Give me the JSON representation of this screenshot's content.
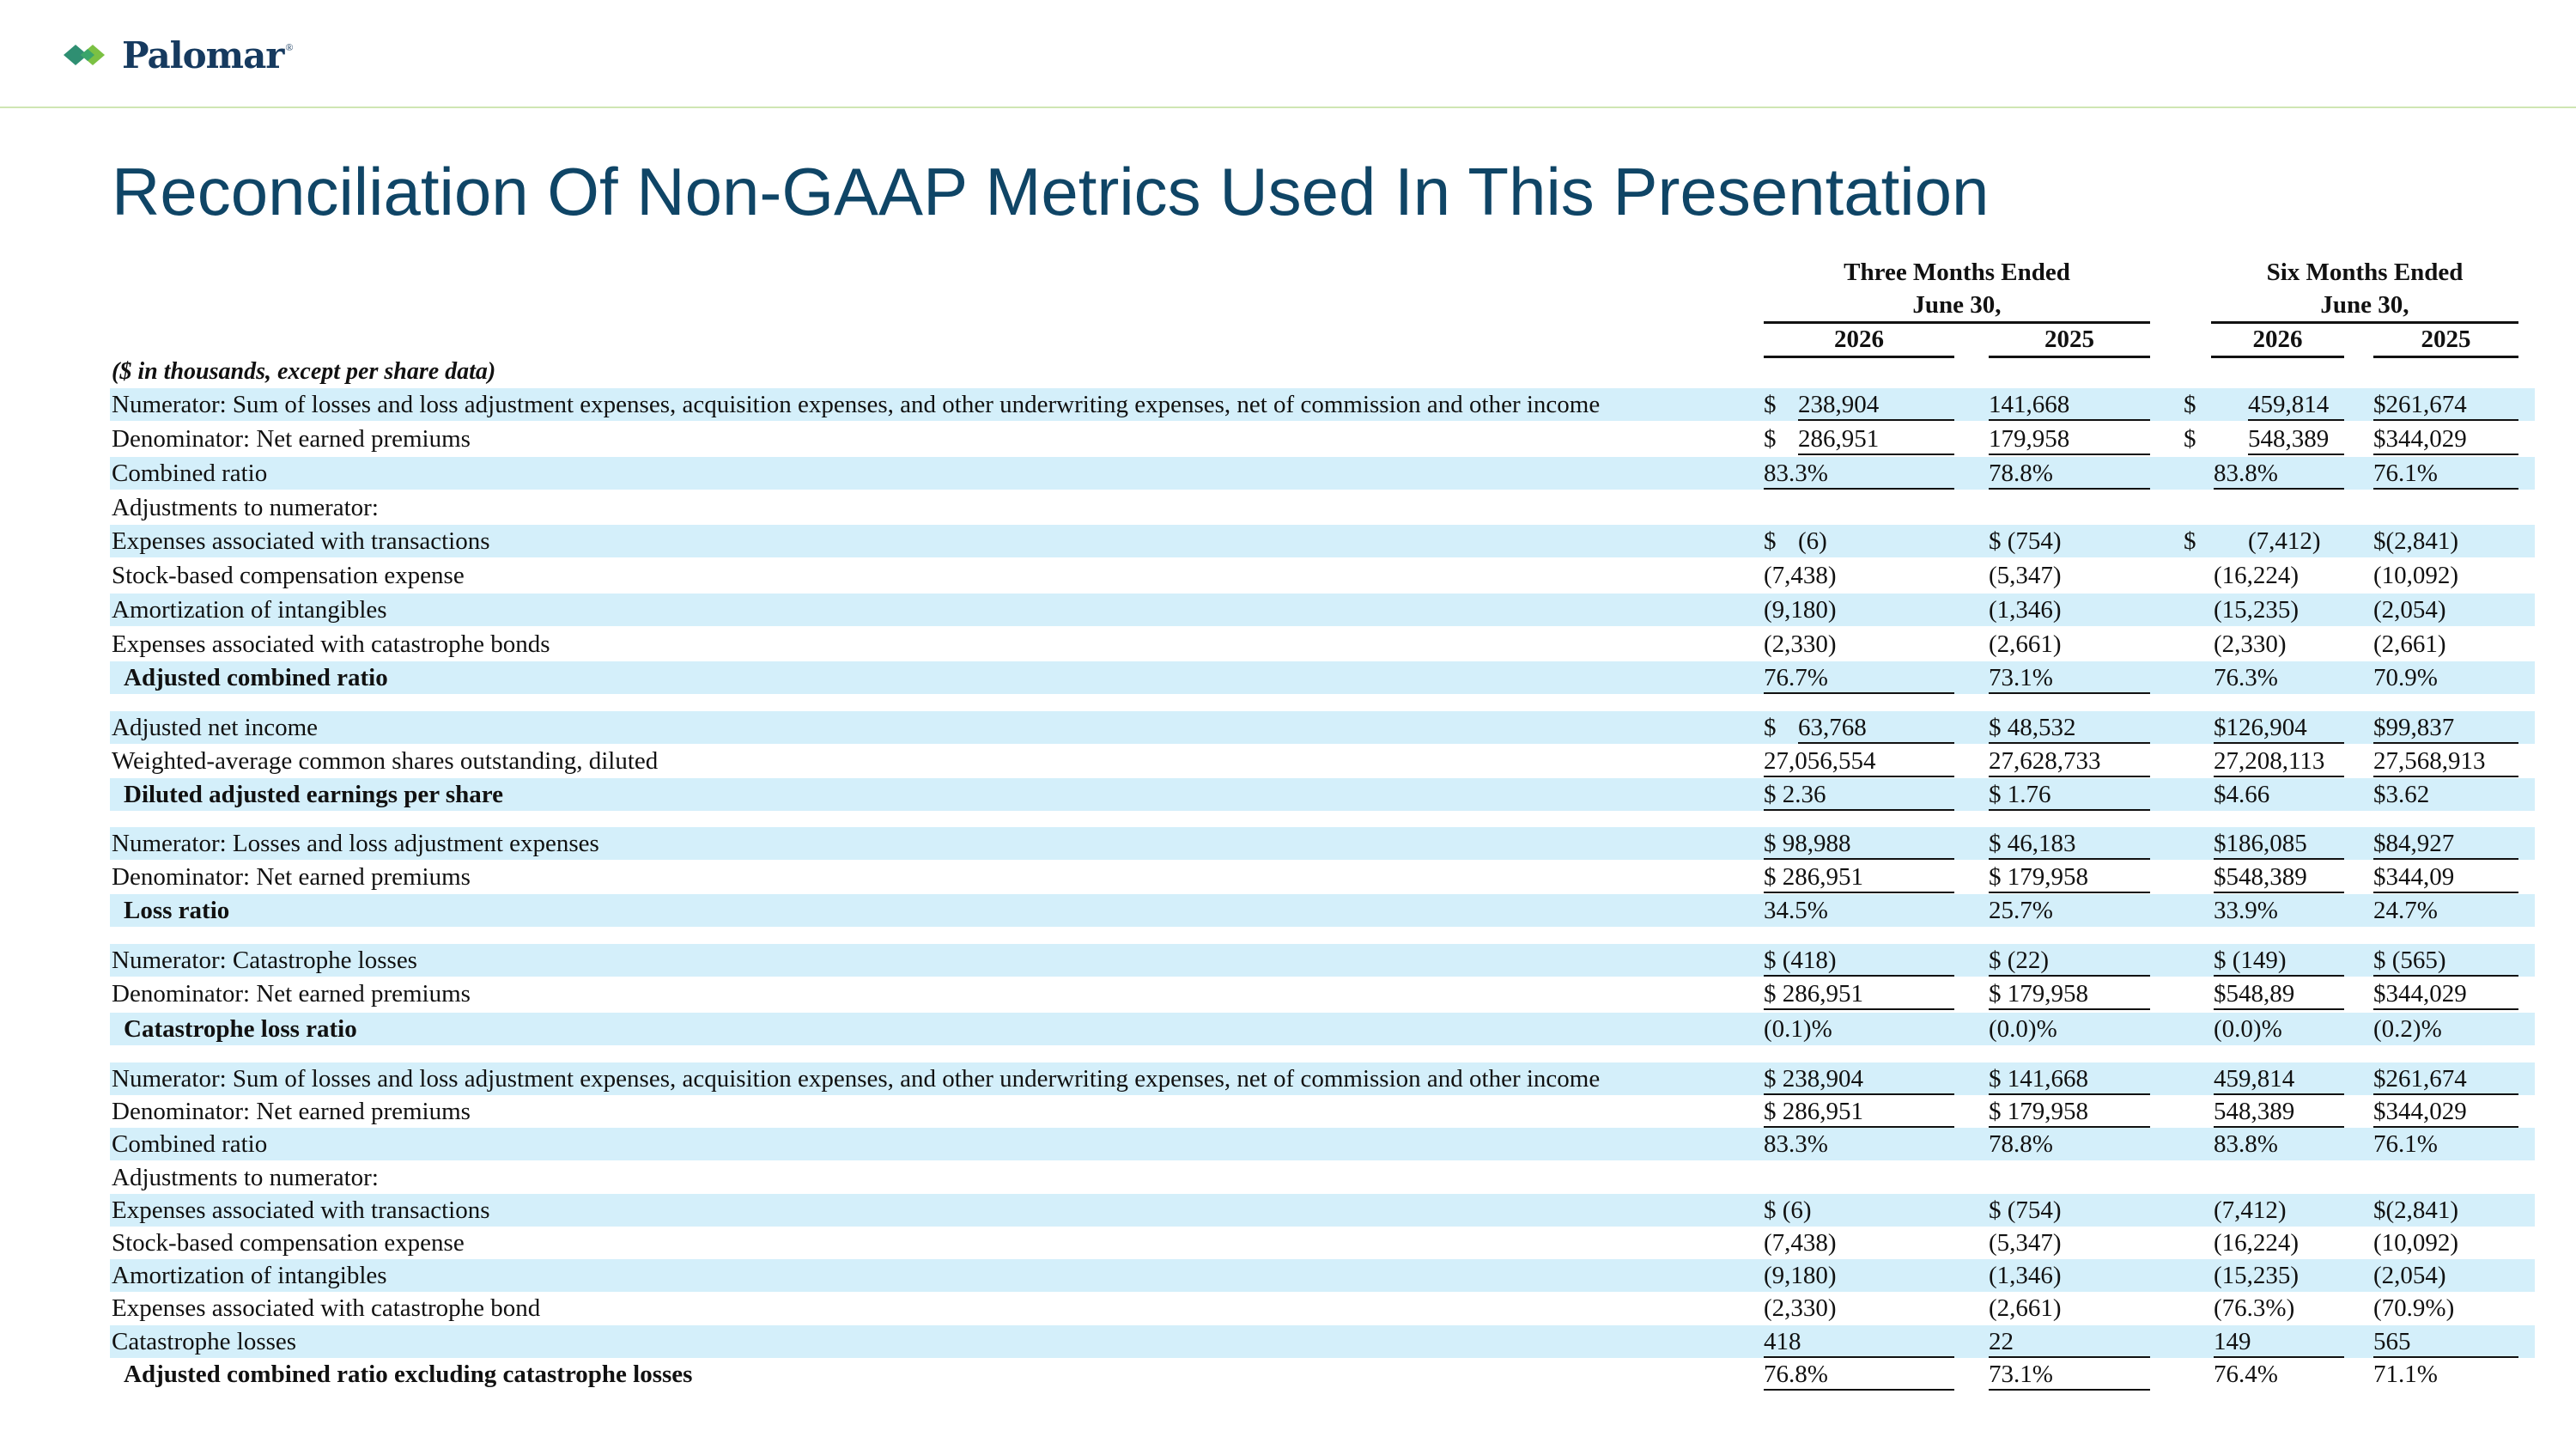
{
  "brand": {
    "name": "Palomar",
    "reg": "®",
    "colors": {
      "title": "#0f4566",
      "shade": "#d4effa",
      "rule": "#cfe6b3"
    }
  },
  "title": "Reconciliation Of Non-GAAP Metrics Used In This Presentation",
  "table": {
    "group_three_line1": "Three Months Ended",
    "group_three_line2": "June 30,",
    "group_six_line1": "Six Months Ended",
    "group_six_line2": "June 30,",
    "years": [
      "2026",
      "2025",
      "2026",
      "2025"
    ],
    "units_note": "($ in thousands, except per share data)",
    "rows": [
      {
        "label": "Numerator: Sum of losses and loss adjustment expenses, acquisition expenses, and other underwriting expenses, net of commission and other income",
        "cur1": "$",
        "v1": "238,904",
        "v2": "141,668",
        "cur3": "$",
        "v3": "459,814",
        "v4": "$261,674"
      },
      {
        "label": "Denominator: Net earned premiums",
        "cur1": "$",
        "v1": "286,951",
        "v2": "179,958",
        "cur3": "$",
        "v3": "548,389",
        "v4": "$344,029"
      },
      {
        "label": "Combined ratio",
        "cur1": "",
        "v1": "83.3%",
        "v2": "78.8%",
        "cur3": "",
        "v3": "83.8%",
        "v4": "76.1%"
      },
      {
        "label": "Adjustments to numerator:",
        "cur1": "",
        "v1": "",
        "v2": "",
        "cur3": "",
        "v3": "",
        "v4": ""
      },
      {
        "label": "Expenses associated with transactions",
        "cur1": "$",
        "v1": "(6)",
        "v2": "$ (754)",
        "cur3": "$",
        "v3": "(7,412)",
        "v4": "$(2,841)"
      },
      {
        "label": "Stock-based compensation expense",
        "cur1": "",
        "v1": "(7,438)",
        "v2": "(5,347)",
        "cur3": "",
        "v3": "(16,224)",
        "v4": "(10,092)"
      },
      {
        "label": "Amortization of intangibles",
        "cur1": "",
        "v1": "(9,180)",
        "v2": "(1,346)",
        "cur3": "",
        "v3": "(15,235)",
        "v4": "(2,054)"
      },
      {
        "label": "Expenses associated with catastrophe bonds",
        "cur1": "",
        "v1": "(2,330)",
        "v2": "(2,661)",
        "cur3": "",
        "v3": "(2,330)",
        "v4": "(2,661)"
      },
      {
        "label": "Adjusted combined ratio",
        "cur1": "",
        "v1": "76.7%",
        "v2": "73.1%",
        "cur3": "",
        "v3": "76.3%",
        "v4": "70.9%"
      },
      {
        "label": "Adjusted net income",
        "cur1": "$",
        "v1": "63,768",
        "v2": "$ 48,532",
        "cur3": "",
        "v3": "$126,904",
        "v4": "$99,837"
      },
      {
        "label": "Weighted-average common shares outstanding, diluted",
        "cur1": "",
        "v1": "27,056,554",
        "v2": "27,628,733",
        "cur3": "",
        "v3": "27,208,113",
        "v4": "27,568,913"
      },
      {
        "label": "Diluted adjusted earnings per share",
        "cur1": "",
        "v1": "$ 2.36",
        "v2": "$ 1.76",
        "cur3": "",
        "v3": "$4.66",
        "v4": "$3.62"
      },
      {
        "label": "Numerator: Losses and loss adjustment expenses",
        "cur1": "",
        "v1": "$ 98,988",
        "v2": "$ 46,183",
        "cur3": "",
        "v3": "$186,085",
        "v4": "$84,927"
      },
      {
        "label": "Denominator: Net earned premiums",
        "cur1": "",
        "v1": "$ 286,951",
        "v2": "$ 179,958",
        "cur3": "",
        "v3": "$548,389",
        "v4": "$344,09"
      },
      {
        "label": "Loss ratio",
        "cur1": "",
        "v1": "34.5%",
        "v2": "25.7%",
        "cur3": "",
        "v3": "33.9%",
        "v4": "24.7%"
      },
      {
        "label": "Numerator: Catastrophe losses",
        "cur1": "",
        "v1": "$ (418)",
        "v2": "$ (22)",
        "cur3": "",
        "v3": "$ (149)",
        "v4": "$ (565)"
      },
      {
        "label": "Denominator: Net earned premiums",
        "cur1": "",
        "v1": "$ 286,951",
        "v2": "$ 179,958",
        "cur3": "",
        "v3": "$548,89",
        "v4": "$344,029"
      },
      {
        "label": "Catastrophe loss ratio",
        "cur1": "",
        "v1": "(0.1)%",
        "v2": "(0.0)%",
        "cur3": "",
        "v3": "(0.0)%",
        "v4": "(0.2)%"
      },
      {
        "label": "Numerator: Sum of losses and loss adjustment expenses, acquisition expenses, and other underwriting expenses, net of commission and other income",
        "cur1": "",
        "v1": "$ 238,904",
        "v2": "$ 141,668",
        "cur3": "",
        "v3": "459,814",
        "v4": "$261,674"
      },
      {
        "label": "Denominator: Net earned premiums",
        "cur1": "",
        "v1": "$ 286,951",
        "v2": "$ 179,958",
        "cur3": "",
        "v3": "548,389",
        "v4": "$344,029"
      },
      {
        "label": "Combined ratio",
        "cur1": "",
        "v1": "83.3%",
        "v2": "78.8%",
        "cur3": "",
        "v3": "83.8%",
        "v4": "76.1%"
      },
      {
        "label": "Adjustments to numerator:",
        "cur1": "",
        "v1": "",
        "v2": "",
        "cur3": "",
        "v3": "",
        "v4": ""
      },
      {
        "label": "Expenses associated with transactions",
        "cur1": "",
        "v1": "$ (6)",
        "v2": "$ (754)",
        "cur3": "",
        "v3": "(7,412)",
        "v4": "$(2,841)"
      },
      {
        "label": "Stock-based compensation expense",
        "cur1": "",
        "v1": "(7,438)",
        "v2": "(5,347)",
        "cur3": "",
        "v3": "(16,224)",
        "v4": "(10,092)"
      },
      {
        "label": "Amortization of intangibles",
        "cur1": "",
        "v1": "(9,180)",
        "v2": "(1,346)",
        "cur3": "",
        "v3": "(15,235)",
        "v4": "(2,054)"
      },
      {
        "label": "Expenses associated with catastrophe bond",
        "cur1": "",
        "v1": "(2,330)",
        "v2": "(2,661)",
        "cur3": "",
        "v3": "(76.3%)",
        "v4": "(70.9%)"
      },
      {
        "label": "Catastrophe losses",
        "cur1": "",
        "v1": "418",
        "v2": "22",
        "cur3": "",
        "v3": "149",
        "v4": "565"
      },
      {
        "label": "Adjusted combined ratio excluding catastrophe losses",
        "cur1": "",
        "v1": "76.8%",
        "v2": "73.1%",
        "cur3": "",
        "v3": "76.4%",
        "v4": "71.1%"
      }
    ]
  }
}
